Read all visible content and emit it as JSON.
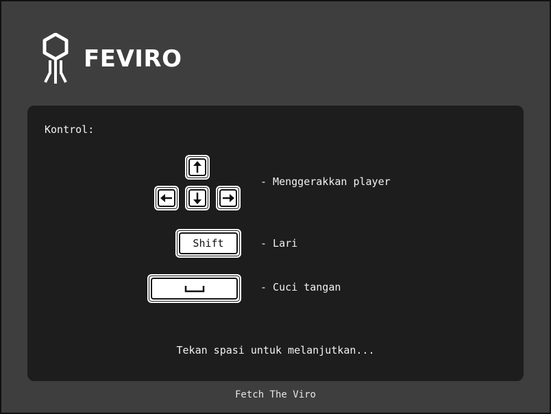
{
  "header": {
    "logo_icon": "virus-logo-icon",
    "brand_name": "FEVIRO"
  },
  "controls": {
    "heading": "Kontrol:",
    "items": [
      {
        "keys": [
          "up-arrow-key",
          "left-arrow-key",
          "down-arrow-key",
          "right-arrow-key"
        ],
        "description": "- Menggerakkan player"
      },
      {
        "keys": [
          "shift-key"
        ],
        "key_label": "Shift",
        "description": "- Lari"
      },
      {
        "keys": [
          "space-key"
        ],
        "description": "- Cuci tangan"
      }
    ]
  },
  "prompt": "Tekan spasi untuk melanjutkan...",
  "footer": "Fetch The Viro",
  "colors": {
    "background": "#3e3e3e",
    "panel": "#1d1d1d",
    "text": "#f2f2f2",
    "key": "#ffffff"
  }
}
